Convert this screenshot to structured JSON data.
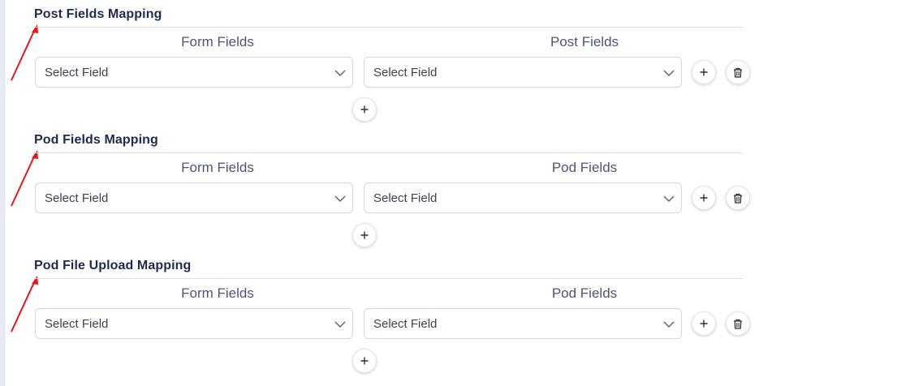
{
  "sections": [
    {
      "title": "Post Fields Mapping",
      "left_header": "Form Fields",
      "right_header": "Post Fields",
      "left_select": "Select Field",
      "right_select": "Select Field"
    },
    {
      "title": "Pod Fields Mapping",
      "left_header": "Form Fields",
      "right_header": "Pod Fields",
      "left_select": "Select Field",
      "right_select": "Select Field"
    },
    {
      "title": "Pod File Upload Mapping",
      "left_header": "Form Fields",
      "right_header": "Pod Fields",
      "left_select": "Select Field",
      "right_select": "Select Field"
    }
  ],
  "icons": {
    "add": "plus-icon",
    "delete": "trash-icon",
    "dropdown": "chevron-down-icon",
    "annotation": "red-arrow-icon"
  },
  "colors": {
    "title": "#1d2b4f",
    "header": "#4e5575",
    "annotation_arrow": "#e8141c"
  }
}
